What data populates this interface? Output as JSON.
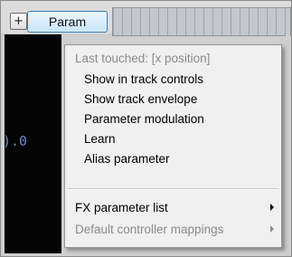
{
  "toolbar": {
    "add_label": "+",
    "param_label": "Param"
  },
  "panel": {
    "value_text": ").0"
  },
  "menu": {
    "header": "Last touched: [x position]",
    "items": [
      "Show in track controls",
      "Show track envelope",
      "Parameter modulation",
      "Learn",
      "Alias parameter"
    ],
    "submenus": [
      {
        "label": "FX parameter list",
        "disabled": false
      },
      {
        "label": "Default controller mappings",
        "disabled": true
      }
    ]
  }
}
